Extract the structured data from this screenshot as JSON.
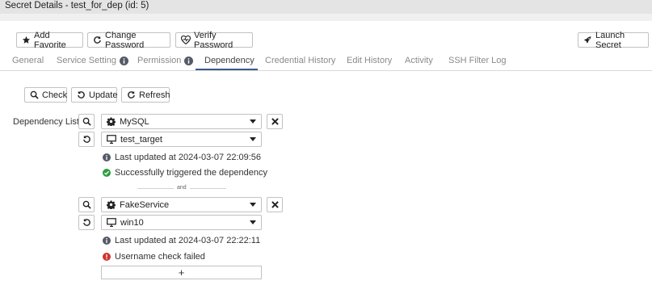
{
  "window": {
    "title": "Secret Details - test_for_dep (id: 5)"
  },
  "toolbar": {
    "add_favorite": "Add Favorite",
    "change_password": "Change Password",
    "verify_password": "Verify Password",
    "launch_secret": "Launch Secret"
  },
  "tabs": [
    {
      "label": "General"
    },
    {
      "label": "Service Setting"
    },
    {
      "label": "Permission"
    },
    {
      "label": "Dependency"
    },
    {
      "label": "Credential History"
    },
    {
      "label": "Edit History"
    },
    {
      "label": "Activity"
    },
    {
      "label": "SSH Filter Log"
    }
  ],
  "actions": {
    "check": "Check",
    "update": "Update",
    "refresh": "Refresh"
  },
  "dependency": {
    "label": "Dependency List",
    "separator": "and",
    "add_symbol": "+",
    "items": [
      {
        "service": "MySQL",
        "target": "test_target",
        "last_updated": "Last updated at 2024-03-07 22:09:56",
        "status": "Successfully triggered the dependency",
        "status_type": "success"
      },
      {
        "service": "FakeService",
        "target": "win10",
        "last_updated": "Last updated at 2024-03-07 22:22:11",
        "status": "Username check failed",
        "status_type": "error"
      }
    ]
  },
  "colors": {
    "success": "#2e9e3e",
    "error": "#d0342c",
    "info": "#555a66",
    "accent": "#3a5a8a"
  }
}
